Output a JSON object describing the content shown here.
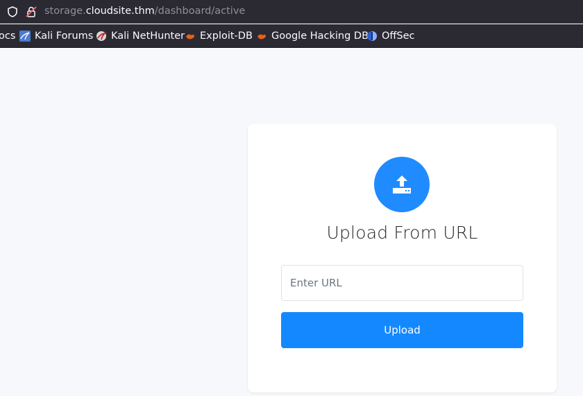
{
  "browser": {
    "url_prefix": "storage.",
    "url_host": "cloudsite.thm",
    "url_path": "/dashboard/active"
  },
  "bookmarks": [
    {
      "label": "ocs",
      "icon": "kali-icon"
    },
    {
      "label": "Kali Forums",
      "icon": "kali-forums-icon"
    },
    {
      "label": "Kali NetHunter",
      "icon": "kali-nethunter-icon"
    },
    {
      "label": "Exploit-DB",
      "icon": "exploitdb-icon"
    },
    {
      "label": "Google Hacking DB",
      "icon": "ghdb-icon"
    },
    {
      "label": "OffSec",
      "icon": "offsec-icon"
    }
  ],
  "card": {
    "icon": "upload-icon",
    "title": "Upload From URL",
    "input_placeholder": "Enter URL",
    "input_value": "",
    "button_label": "Upload"
  },
  "colors": {
    "accent": "#1489ff",
    "browser_bg": "#2b2a33",
    "page_bg": "#f7f8fb"
  }
}
